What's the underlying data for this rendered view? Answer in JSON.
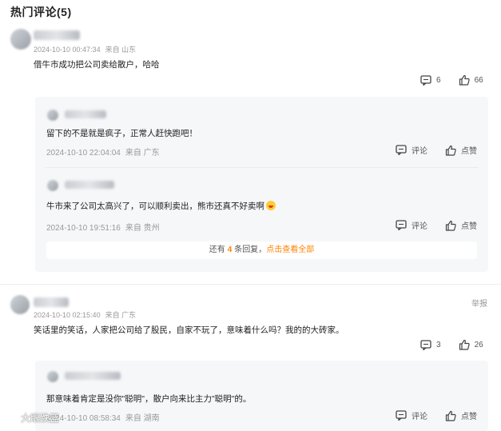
{
  "header": {
    "title": "热门评论(5)"
  },
  "comments": [
    {
      "date": "2024-10-10 00:47:34",
      "location": "来自 山东",
      "text": "借牛市成功把公司卖给散户，哈哈",
      "comment_count": "6",
      "like_count": "66",
      "replies": [
        {
          "text": "留下的不是就是疯子，正常人赶快跑吧！",
          "date": "2024-10-10 22:04:04",
          "location": "来自 广东",
          "comment_label": "评论",
          "like_label": "点赞"
        },
        {
          "text": "牛市来了公司太高兴了，可以顺利卖出，熊市还真不好卖啊",
          "date": "2024-10-10 19:51:16",
          "location": "来自 贵州",
          "comment_label": "评论",
          "like_label": "点赞"
        }
      ],
      "more": {
        "prefix": "还有",
        "count": "4",
        "suffix": "条回复，",
        "link": "点击查看全部"
      }
    },
    {
      "date": "2024-10-10 02:15:40",
      "location": "来自 广东",
      "text": "笑话里的笑话，人家把公司给了股民，自家不玩了，意味着什么吗？我的的大砖家。",
      "comment_count": "3",
      "like_count": "26",
      "report_label": "举报",
      "replies": [
        {
          "text": "那意味着肯定是没你\"聪明\"，散户向来比主力\"聪明\"的。",
          "date": "2024-10-10 08:58:34",
          "location": "来自 湖南",
          "comment_label": "评论",
          "like_label": "点赞"
        }
      ]
    }
  ],
  "watermark": {
    "text": "大眼跌蓝"
  },
  "icons": {
    "comment": "comment-icon",
    "like": "thumbs-up-icon",
    "emoji": "laughing-emoji-icon",
    "watermark": "weibo-logo-icon"
  },
  "colors": {
    "accent": "#ff8200",
    "meta": "#999999",
    "reply_bg": "#f6f7f9"
  }
}
